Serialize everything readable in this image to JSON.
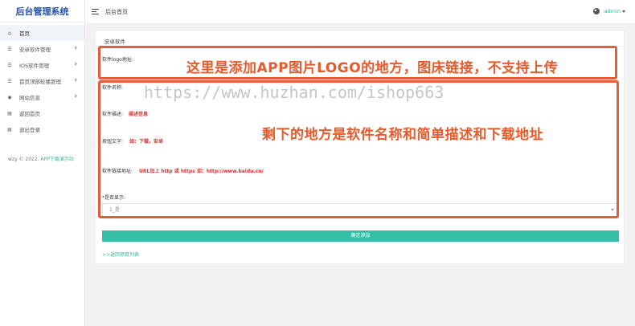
{
  "brand": {
    "title": "后台管理系统"
  },
  "sidebar": {
    "items": [
      {
        "label": "首页",
        "icon": "home-icon",
        "glyph": "⌂",
        "has_children": false
      },
      {
        "label": "安卓软件管理",
        "icon": "list-icon",
        "glyph": "☰",
        "has_children": true
      },
      {
        "label": "IOS软件管理",
        "icon": "list-icon",
        "glyph": "☰",
        "has_children": true
      },
      {
        "label": "首页顶部轮播管理",
        "icon": "list-icon",
        "glyph": "☰",
        "has_children": true
      },
      {
        "label": "网站信息",
        "icon": "palette-icon",
        "glyph": "◉",
        "has_children": true
      },
      {
        "label": "返回首页",
        "icon": "document-icon",
        "glyph": "▤",
        "has_children": false
      },
      {
        "label": "退出登录",
        "icon": "document-icon",
        "glyph": "▤",
        "has_children": false
      }
    ],
    "footer_text": "wzy © 2022.",
    "footer_link": "APP下载演示站"
  },
  "header": {
    "title": "后台首页",
    "user": "admin"
  },
  "card": {
    "title": "安卓软件",
    "fields": {
      "logo_label": "软件logo地址:",
      "name_label": "软件名称:",
      "desc_label": "软件描述:",
      "desc_value": "描述信息",
      "button_label": "按钮文字:",
      "button_value": "如：下载，安卓",
      "url_label": "软件链接地址:",
      "url_value": "URL加上 http 或 https 如：http://www.baidu.cn/",
      "display_label": "*是否显示:",
      "display_value": "1_是"
    },
    "submit_label": "确定添加",
    "back_link": ">>返回项目列表"
  },
  "annotations": {
    "top": "这里是添加APP图片LOGO的地方，图床链接，不支持上传",
    "middle": "剩下的地方是软件名称和简单描述和下载地址",
    "color": "#e45c3e"
  },
  "watermark": "https://www.huzhan.com/ishop663",
  "colors": {
    "accent": "#36bfa6",
    "brand": "#1f4fa8",
    "highlight": "#d9302f"
  }
}
